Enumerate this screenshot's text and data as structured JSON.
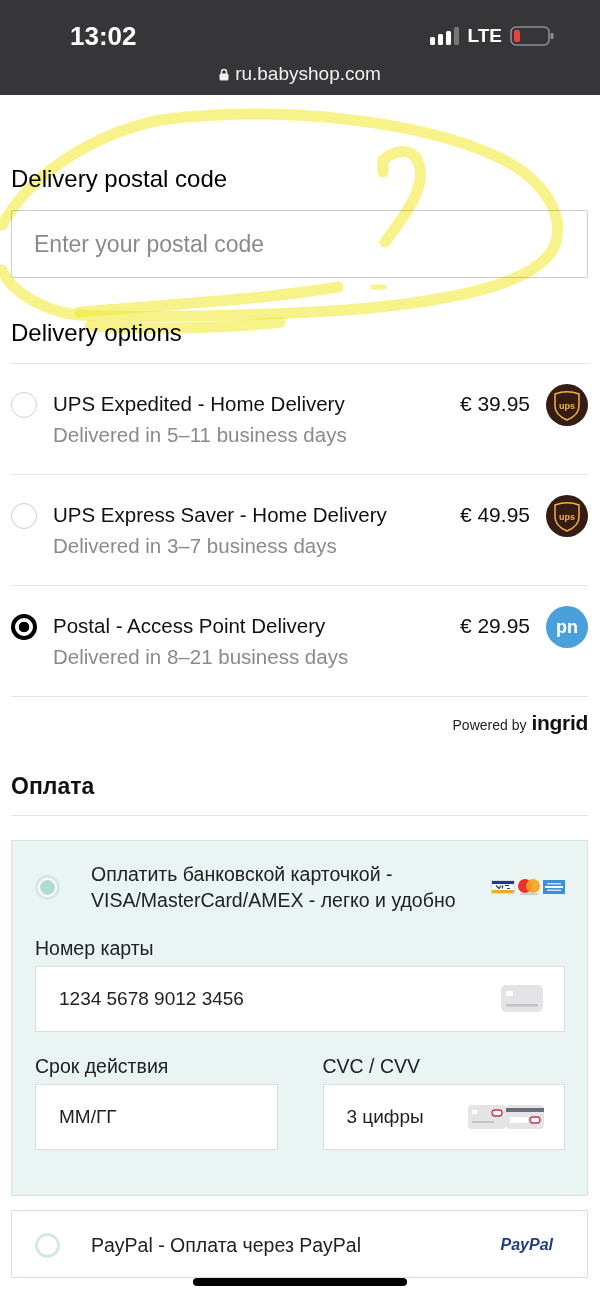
{
  "status_bar": {
    "time": "13:02",
    "network": "LTE",
    "url": "ru.babyshop.com"
  },
  "postal_code": {
    "label": "Delivery postal code",
    "placeholder": "Enter your postal code"
  },
  "delivery": {
    "heading": "Delivery options",
    "options": [
      {
        "title": "UPS Expedited - Home Delivery",
        "eta": "Delivered in 5–11 business days",
        "price": "€ 39.95",
        "carrier": {
          "kind": "ups",
          "text": "ups"
        },
        "selected": false
      },
      {
        "title": "UPS Express Saver - Home Delivery",
        "eta": "Delivered in 3–7 business days",
        "price": "€ 49.95",
        "carrier": {
          "kind": "ups",
          "text": "ups"
        },
        "selected": false
      },
      {
        "title": "Postal - Access Point Delivery",
        "eta": "Delivered in 8–21 business days",
        "price": "€ 29.95",
        "carrier": {
          "kind": "pn",
          "text": "pn"
        },
        "selected": true
      }
    ],
    "powered_by": {
      "label": "Powered by",
      "brand": "ingrid"
    }
  },
  "payment": {
    "heading": "Оплата",
    "methods": [
      {
        "kind": "card",
        "label": "Оплатить банковской карточкой - VISA/MasterCard/AMEX - легко и удобно",
        "selected": true,
        "fields": [
          {
            "kind": "number",
            "label": "Номер карты",
            "placeholder": "1234 5678 9012 3456"
          },
          {
            "kind": "expiry",
            "label": "Срок действия",
            "placeholder": "ММ/ГГ"
          },
          {
            "kind": "cvc",
            "label": "CVC / CVV",
            "placeholder": "3 цифры"
          }
        ]
      },
      {
        "kind": "paypal",
        "label": "PayPal - Оплата через PayPal",
        "selected": false,
        "logo": "PayPal"
      }
    ]
  }
}
